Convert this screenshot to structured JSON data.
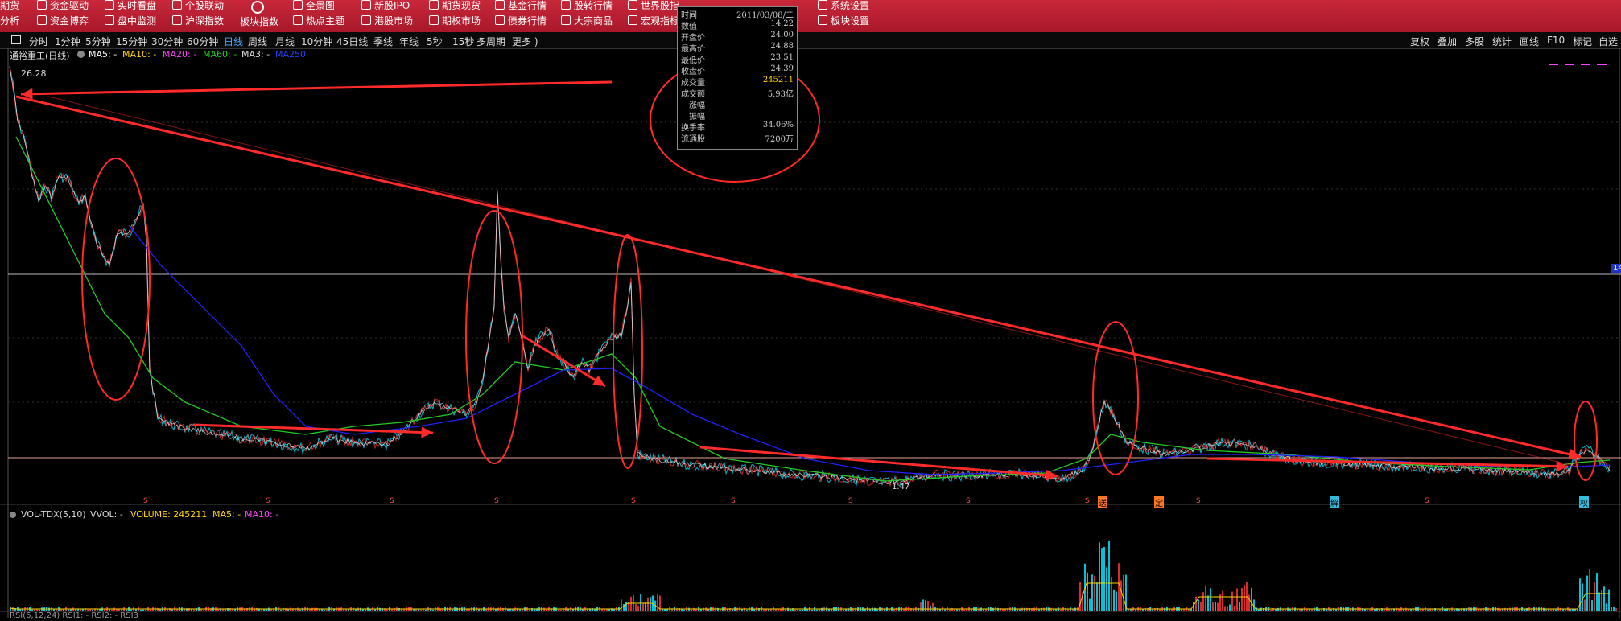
{
  "menu": {
    "row1": [
      "期货",
      "资金驱动",
      "实时看盘",
      "个股联动",
      "板块指数",
      "全景图",
      "新股IPO",
      "期货现货",
      "基金行情",
      "股转行情",
      "世界股指",
      "系统设置"
    ],
    "row2": [
      "分析",
      "资金博弈",
      "盘中监测",
      "沪深指数",
      "热点主题",
      "港股市场",
      "期权市场",
      "债券行情",
      "大宗商品",
      "宏观指标",
      "板块设置"
    ],
    "board_label": "板块指数"
  },
  "timeframes": [
    "分时",
    "1分钟",
    "5分钟",
    "15分钟",
    "30分钟",
    "60分钟",
    "日线",
    "周线",
    "月线",
    "10分钟",
    "45日线",
    "季线",
    "年线",
    "5秒",
    "15秒",
    "多周期",
    "更多 )"
  ],
  "active_timeframe": "日线",
  "toolbar_right": [
    "复权",
    "叠加",
    "多股",
    "统计",
    "画线",
    "F10",
    "标记",
    "自选"
  ],
  "legend": {
    "stock": "通裕重工(日线)",
    "ma5": "MA5: -",
    "ma10": "MA10: -",
    "ma20": "MA20: -",
    "ma60": "MA60: -",
    "ma3": "MA3: -",
    "ma250": "MA250"
  },
  "vol_legend": {
    "name": "VOL-TDX(5,10)",
    "vvol": "VVOL: -",
    "volume": "VOLUME: 245211",
    "ma5": "MA5: -",
    "ma10": "MA10: -"
  },
  "bottom_legend": "RSI(6,12,24)  RSI1: -  RSI2: -  RSI3",
  "price_labels": {
    "high": "26.28",
    "low": "1.47",
    "right_marker": "14"
  },
  "markers": [
    "送",
    "定",
    "解",
    "权"
  ],
  "info_popup": {
    "rows": [
      {
        "k": "时间",
        "v": "2011/03/08/二"
      },
      {
        "k": "数值",
        "v": "14.22"
      },
      {
        "k": "开盘价",
        "v": "24.00"
      },
      {
        "k": "最高价",
        "v": "24.88"
      },
      {
        "k": "最低价",
        "v": "23.51"
      },
      {
        "k": "收盘价",
        "v": "24.39"
      },
      {
        "k": "成交量",
        "v": "245211"
      },
      {
        "k": "成交额",
        "v": "5.93亿"
      },
      {
        "k": "涨幅",
        "v": ""
      },
      {
        "k": "振幅",
        "v": ""
      },
      {
        "k": "换手率",
        "v": "34.06%"
      },
      {
        "k": "流通股",
        "v": "7200万"
      }
    ]
  },
  "colors": {
    "up": "#ff3333",
    "down": "#00e5ff",
    "ma5": "#ffffff",
    "ma10": "#ffd700",
    "ma20": "#ff44ff",
    "ma60": "#22cc22",
    "ma250": "#2222ff",
    "annotation": "#ff2a2a"
  },
  "chart_data": {
    "type": "line",
    "title": "通裕重工(日线)",
    "series": [
      {
        "name": "MA5",
        "values": []
      },
      {
        "name": "MA60",
        "values": []
      },
      {
        "name": "MA250",
        "values": []
      }
    ]
  }
}
